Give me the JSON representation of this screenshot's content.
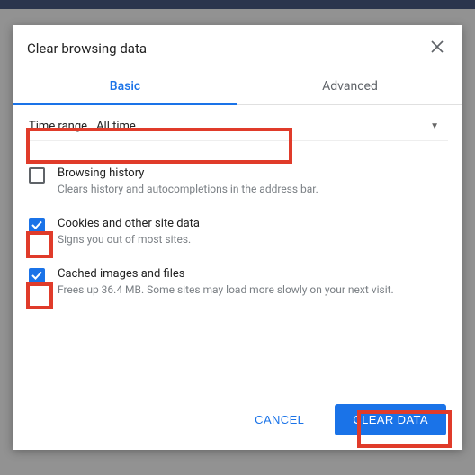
{
  "dialog": {
    "title": "Clear browsing data",
    "tabs": {
      "basic": "Basic",
      "advanced": "Advanced"
    },
    "time": {
      "label": "Time range",
      "value": "All time"
    },
    "options": [
      {
        "title": "Browsing history",
        "desc": "Clears history and autocompletions in the address bar.",
        "checked": false
      },
      {
        "title": "Cookies and other site data",
        "desc": "Signs you out of most sites.",
        "checked": true
      },
      {
        "title": "Cached images and files",
        "desc": "Frees up 36.4 MB. Some sites may load more slowly on your next visit.",
        "checked": true
      }
    ],
    "buttons": {
      "cancel": "CANCEL",
      "clear": "CLEAR DATA"
    }
  }
}
